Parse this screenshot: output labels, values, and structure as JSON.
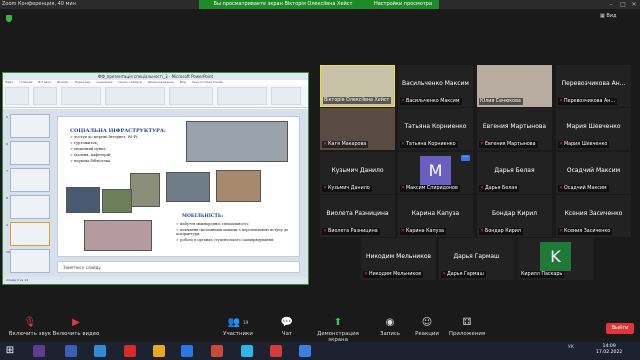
{
  "window": {
    "app_title": "Zoom Конференция, 40 мин",
    "sharing_banner": "Вы просматриваете экран Вікторія Олексіївна Хейст",
    "view_options": "Настройки просмотра",
    "view_button": "Вид"
  },
  "powerpoint": {
    "title": "ФФ_презентація спеціальності_3 - Microsoft PowerPoint",
    "tabs": [
      "Файл",
      "Главная",
      "Вставка",
      "Дизайн",
      "Переходы",
      "Анимация",
      "Показ слайдов",
      "Рецензирование",
      "Вид",
      "Save Acrobat Create"
    ],
    "slide": {
      "title": "СОЦІАЛЬНА ІНФРАСТРУКТУРА:",
      "bullets": [
        "доступ до мережі Інтернет, Wi-Fi;",
        "гуртожиток;",
        "медичний пункт;",
        "їдальня, кафетерій;",
        "наукова бібліотека."
      ],
      "mobility_title": "МОБІЛЬНІСТЬ:",
      "mobility_bullets": [
        "набуття міжнародної спеціальності;",
        "навчання іноземними мовами з перспективою вступу до аспірантури;",
        "робота в органах студентського самоврядування."
      ]
    },
    "notes": "Заметки к слайду",
    "status": "Слайд 9 из 14"
  },
  "participants": [
    {
      "name": "Вікторія Олексіївна Хейст",
      "label": "Вікторія Олексіївна Хейст",
      "video": true,
      "speaking": true,
      "muted": false
    },
    {
      "name": "Васильченко Максим",
      "label": "Васильченко Максим",
      "video": false,
      "muted": true
    },
    {
      "name": "Юлия Сенюкова",
      "label": "Юлия Сенюкова",
      "video": true,
      "muted": false
    },
    {
      "name": "Перевозчикова Ан...",
      "label": "Перевозчикова Ан...",
      "video": false,
      "muted": true
    },
    {
      "name": "Катя Макарова",
      "label": "Катя Макарова",
      "video": true,
      "muted": true
    },
    {
      "name": "Татьяна Корниенко",
      "label": "Татьяна Корниенко",
      "video": false,
      "muted": true
    },
    {
      "name": "Евгения Мартынова",
      "label": "Евгения Мартынова",
      "video": false,
      "muted": true
    },
    {
      "name": "Мария Шевченко",
      "label": "Мария Шевченко",
      "video": false,
      "muted": true
    },
    {
      "name": "Кузьмич Данило",
      "label": "Кузьмич Данило",
      "video": false,
      "muted": true
    },
    {
      "name": "M",
      "label": "Максим Спиридонов",
      "video": false,
      "avatar": true,
      "avatar_color": "#6a5fc1",
      "muted": true
    },
    {
      "name": "Дарья Белая",
      "label": "Дарья Белая",
      "video": false,
      "muted": true
    },
    {
      "name": "Осадчий Максим",
      "label": "Осадчий Максим",
      "video": false,
      "muted": true
    },
    {
      "name": "Виолета Разницина",
      "label": "Виолета Разницина",
      "video": false,
      "muted": true
    },
    {
      "name": "Карина Капуза",
      "label": "Карина Капуза",
      "video": false,
      "muted": true
    },
    {
      "name": "Бондар Кирил",
      "label": "Бондар Кирил",
      "video": false,
      "muted": true
    },
    {
      "name": "Ксения Засиченко",
      "label": "Ксения Засиченко",
      "video": false,
      "muted": true
    },
    {
      "name": "Никодим Мельников",
      "label": "Никодим Мельников",
      "video": false,
      "muted": true
    },
    {
      "name": "Дарья Гармаш",
      "label": "Дарья Гармаш",
      "video": false,
      "muted": true
    },
    {
      "name": "K",
      "label": "Кирилл Паскарь",
      "video": false,
      "avatar": true,
      "avatar_color": "#1f7a3a",
      "muted": false
    }
  ],
  "toolbar": {
    "unmute": "Включить звук",
    "video": "Включить видео",
    "participants": "Участники",
    "participants_count": "19",
    "chat": "Чат",
    "share": "Демонстрация экрана",
    "record": "Запись",
    "reactions": "Реакции",
    "apps": "Приложения",
    "end": "Выйти"
  },
  "taskbar": {
    "lang": "УК",
    "time": "14:09",
    "date": "17.02.2022"
  },
  "colors": {
    "share_green": "#1f8a2a",
    "mute_red": "#e0353b",
    "end_red": "#e0353b",
    "speaker_yellow": "#f0e020"
  }
}
